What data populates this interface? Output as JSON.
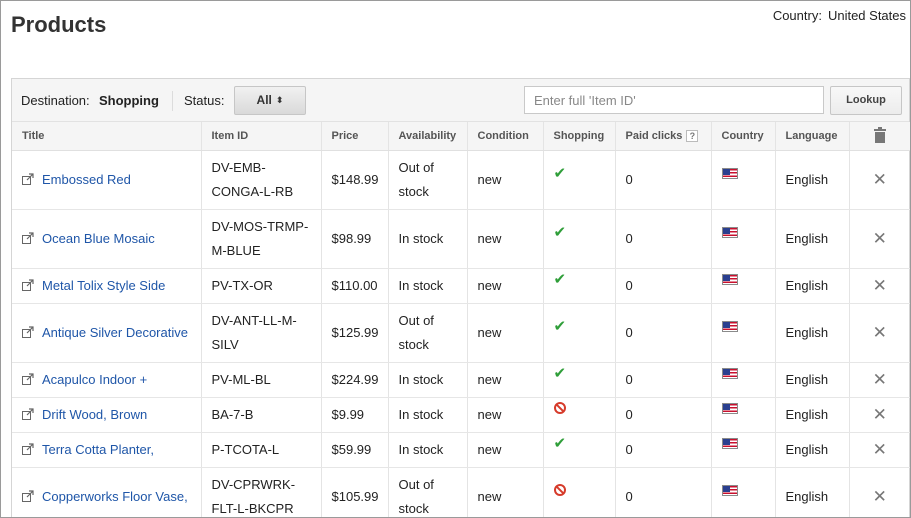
{
  "header": {
    "title": "Products",
    "country_label": "Country:",
    "country_value": "United States"
  },
  "filters": {
    "destination_label": "Destination:",
    "destination_value": "Shopping",
    "status_label": "Status:",
    "status_value": "All",
    "search_placeholder": "Enter full 'Item ID'",
    "search_value": "",
    "lookup_label": "Lookup"
  },
  "table": {
    "columns": [
      "Title",
      "Item ID",
      "Price",
      "Availability",
      "Condition",
      "Shopping",
      "Paid clicks",
      "Country",
      "Language",
      ""
    ],
    "paid_clicks_help": "?",
    "rows": [
      {
        "title": "Embossed Red",
        "item_id": "DV-EMB-CONGA-L-RB",
        "price": "$148.99",
        "availability": "Out of stock",
        "condition": "new",
        "shopping": "check",
        "paid_clicks": "0",
        "country": "us-flag",
        "language": "English"
      },
      {
        "title": "Ocean Blue Mosaic",
        "item_id": "DV-MOS-TRMP-M-BLUE",
        "price": "$98.99",
        "availability": "In stock",
        "condition": "new",
        "shopping": "check",
        "paid_clicks": "0",
        "country": "us-flag",
        "language": "English"
      },
      {
        "title": "Metal Tolix Style Side",
        "item_id": "PV-TX-OR",
        "price": "$110.00",
        "availability": "In stock",
        "condition": "new",
        "shopping": "check",
        "paid_clicks": "0",
        "country": "us-flag",
        "language": "English"
      },
      {
        "title": "Antique Silver Decorative",
        "item_id": "DV-ANT-LL-M-SILV",
        "price": "$125.99",
        "availability": "Out of stock",
        "condition": "new",
        "shopping": "check",
        "paid_clicks": "0",
        "country": "us-flag",
        "language": "English"
      },
      {
        "title": "Acapulco Indoor +",
        "item_id": "PV-ML-BL",
        "price": "$224.99",
        "availability": "In stock",
        "condition": "new",
        "shopping": "check",
        "paid_clicks": "0",
        "country": "us-flag",
        "language": "English"
      },
      {
        "title": "Drift Wood, Brown",
        "item_id": "BA-7-B",
        "price": "$9.99",
        "availability": "In stock",
        "condition": "new",
        "shopping": "disapproved",
        "paid_clicks": "0",
        "country": "us-flag",
        "language": "English"
      },
      {
        "title": "Terra Cotta Planter,",
        "item_id": "P-TCOTA-L",
        "price": "$59.99",
        "availability": "In stock",
        "condition": "new",
        "shopping": "check",
        "paid_clicks": "0",
        "country": "us-flag",
        "language": "English"
      },
      {
        "title": "Copperworks Floor Vase,",
        "item_id": "DV-CPRWRK-FLT-L-BKCPR",
        "price": "$105.99",
        "availability": "Out of stock",
        "condition": "new",
        "shopping": "disapproved",
        "paid_clicks": "0",
        "country": "us-flag",
        "language": "English"
      }
    ]
  },
  "icons": {
    "check": "✔",
    "delete": "✕"
  },
  "colors": {
    "link": "#1f56a8",
    "check": "#2f9e39",
    "disapproved": "#d63b2b"
  }
}
